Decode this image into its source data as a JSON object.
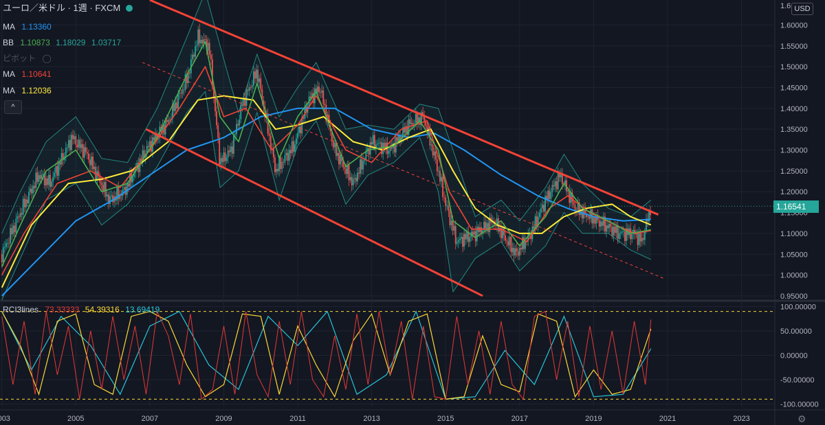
{
  "header": {
    "symbol_title": "ユーロ／米ドル · 1週 · FXCM",
    "currency_button": "USD",
    "last_price_tag": "1.16541",
    "collapse_button": "^"
  },
  "indicators": {
    "ma1": {
      "label": "MA",
      "value": "1.13360",
      "color": "#2196f3"
    },
    "bb": {
      "label": "BB",
      "basis": "1.10873",
      "upper": "1.18029",
      "lower": "1.03717",
      "basis_color": "#4caf50",
      "band_color": "#26a69a"
    },
    "pivot": {
      "label": "ピボット"
    },
    "ma2": {
      "label": "MA",
      "value": "1.10641",
      "color": "#f44336"
    },
    "ma3": {
      "label": "MA",
      "value": "1.12036",
      "color": "#ffeb3b"
    },
    "rci": {
      "label": "RCI3lines",
      "short": "73.33333",
      "mid": "54.39316",
      "long": "13.69419",
      "short_color": "#e53935",
      "mid_color": "#fdd835",
      "long_color": "#26c6da"
    }
  },
  "chart_data": {
    "type": "line",
    "title": "ユーロ／米ドル · 1週 · FXCM",
    "price_axis": {
      "ticks": [
        "1.60000",
        "1.55000",
        "1.50000",
        "1.45000",
        "1.40000",
        "1.35000",
        "1.30000",
        "1.25000",
        "1.20000",
        "1.15000",
        "1.10000",
        "1.05000",
        "1.00000",
        "0.95000"
      ],
      "top_partial_tick": "1.6",
      "range": [
        0.945,
        1.66
      ]
    },
    "rci_axis": {
      "ticks": [
        "100.00000",
        "50.00000",
        "0.00000",
        "-50.00000",
        "-100.00000"
      ],
      "range": [
        -105,
        105
      ],
      "levels": [
        90,
        -90
      ]
    },
    "time_axis": {
      "ticks": [
        "2003",
        "2005",
        "2007",
        "2009",
        "2011",
        "2013",
        "2015",
        "2017",
        "2019",
        "2021",
        "2023"
      ],
      "range": [
        2002.95,
        2023.9
      ]
    },
    "last_price": 1.16541,
    "price_series": {
      "x": [
        2003.0,
        2003.5,
        2004.0,
        2004.3,
        2004.9,
        2005.3,
        2005.9,
        2006.3,
        2006.9,
        2007.5,
        2008.0,
        2008.3,
        2008.6,
        2008.9,
        2009.2,
        2009.5,
        2009.9,
        2010.4,
        2010.9,
        2011.3,
        2011.6,
        2012.0,
        2012.5,
        2013.0,
        2013.5,
        2014.0,
        2014.4,
        2014.8,
        2015.0,
        2015.3,
        2015.8,
        2016.3,
        2016.9,
        2017.3,
        2017.7,
        2018.1,
        2018.5,
        2018.9,
        2019.3,
        2019.7,
        2020.1,
        2020.3,
        2020.55
      ],
      "close": [
        1.05,
        1.15,
        1.24,
        1.22,
        1.33,
        1.29,
        1.18,
        1.2,
        1.3,
        1.37,
        1.47,
        1.57,
        1.55,
        1.27,
        1.3,
        1.41,
        1.49,
        1.25,
        1.31,
        1.42,
        1.45,
        1.3,
        1.22,
        1.32,
        1.3,
        1.36,
        1.38,
        1.25,
        1.17,
        1.08,
        1.1,
        1.13,
        1.05,
        1.1,
        1.18,
        1.24,
        1.16,
        1.14,
        1.12,
        1.1,
        1.1,
        1.08,
        1.165
      ]
    },
    "ma_blue": {
      "x": [
        2003.0,
        2004.0,
        2005.0,
        2006.0,
        2007.0,
        2008.0,
        2009.0,
        2010.0,
        2011.0,
        2012.0,
        2013.0,
        2014.0,
        2014.7,
        2015.5,
        2016.5,
        2017.5,
        2018.3,
        2019.0,
        2019.8,
        2020.55
      ],
      "y": [
        0.95,
        1.04,
        1.13,
        1.18,
        1.24,
        1.3,
        1.33,
        1.38,
        1.4,
        1.4,
        1.35,
        1.33,
        1.34,
        1.3,
        1.24,
        1.19,
        1.16,
        1.14,
        1.13,
        1.1336
      ]
    },
    "ma_yellow": {
      "x": [
        2003.0,
        2003.8,
        2004.8,
        2005.7,
        2006.5,
        2007.5,
        2008.3,
        2009.0,
        2009.8,
        2010.4,
        2011.0,
        2011.7,
        2012.5,
        2013.3,
        2014.0,
        2014.6,
        2015.2,
        2015.8,
        2016.4,
        2017.0,
        2017.6,
        2018.2,
        2018.8,
        2019.5,
        2020.0,
        2020.55
      ],
      "y": [
        0.97,
        1.12,
        1.22,
        1.23,
        1.25,
        1.32,
        1.42,
        1.43,
        1.42,
        1.35,
        1.36,
        1.38,
        1.32,
        1.3,
        1.33,
        1.35,
        1.25,
        1.16,
        1.12,
        1.1,
        1.1,
        1.14,
        1.16,
        1.17,
        1.14,
        1.1204
      ]
    },
    "ma_red": {
      "x": [
        2003.0,
        2003.6,
        2004.5,
        2005.4,
        2006.2,
        2007.0,
        2007.8,
        2008.5,
        2009.0,
        2009.6,
        2010.3,
        2011.0,
        2011.5,
        2012.3,
        2013.0,
        2013.8,
        2014.5,
        2015.1,
        2015.7,
        2016.5,
        2017.2,
        2017.8,
        2018.3,
        2018.9,
        2019.6,
        2020.1,
        2020.55
      ],
      "y": [
        1.0,
        1.1,
        1.22,
        1.25,
        1.21,
        1.3,
        1.4,
        1.5,
        1.38,
        1.4,
        1.3,
        1.36,
        1.43,
        1.3,
        1.27,
        1.35,
        1.37,
        1.2,
        1.11,
        1.11,
        1.08,
        1.16,
        1.19,
        1.15,
        1.12,
        1.1,
        1.1064
      ]
    },
    "bb_basis": {
      "x": [
        2003.0,
        2003.5,
        2004.2,
        2005.0,
        2005.7,
        2006.4,
        2007.2,
        2008.0,
        2008.5,
        2008.9,
        2009.4,
        2009.9,
        2010.5,
        2011.0,
        2011.5,
        2012.3,
        2012.9,
        2013.6,
        2014.3,
        2014.8,
        2015.2,
        2015.8,
        2016.5,
        2017.0,
        2017.7,
        2018.2,
        2018.7,
        2019.4,
        2020.0,
        2020.55
      ],
      "y": [
        1.02,
        1.12,
        1.25,
        1.3,
        1.2,
        1.22,
        1.33,
        1.48,
        1.56,
        1.38,
        1.32,
        1.46,
        1.28,
        1.38,
        1.44,
        1.26,
        1.3,
        1.31,
        1.37,
        1.3,
        1.13,
        1.09,
        1.13,
        1.07,
        1.14,
        1.22,
        1.16,
        1.13,
        1.1,
        1.1087
      ]
    },
    "bb_upper": {
      "x": [
        2003.0,
        2003.5,
        2004.2,
        2005.0,
        2005.7,
        2006.4,
        2007.2,
        2008.0,
        2008.5,
        2008.9,
        2009.4,
        2009.9,
        2010.5,
        2011.0,
        2011.5,
        2012.3,
        2012.9,
        2013.6,
        2014.3,
        2014.8,
        2015.2,
        2015.8,
        2016.5,
        2017.0,
        2017.7,
        2018.2,
        2018.7,
        2019.4,
        2020.0,
        2020.55
      ],
      "y": [
        1.1,
        1.2,
        1.32,
        1.38,
        1.28,
        1.27,
        1.4,
        1.57,
        1.68,
        1.55,
        1.39,
        1.53,
        1.38,
        1.45,
        1.51,
        1.35,
        1.36,
        1.35,
        1.41,
        1.4,
        1.3,
        1.14,
        1.18,
        1.13,
        1.21,
        1.29,
        1.22,
        1.16,
        1.14,
        1.1803
      ]
    },
    "bb_lower": {
      "x": [
        2003.0,
        2003.5,
        2004.2,
        2005.0,
        2005.7,
        2006.4,
        2007.2,
        2008.0,
        2008.5,
        2008.9,
        2009.4,
        2009.9,
        2010.5,
        2011.0,
        2011.5,
        2012.3,
        2012.9,
        2013.6,
        2014.3,
        2014.8,
        2015.2,
        2015.8,
        2016.5,
        2017.0,
        2017.7,
        2018.2,
        2018.7,
        2019.4,
        2020.0,
        2020.55
      ],
      "y": [
        0.94,
        1.04,
        1.18,
        1.22,
        1.12,
        1.17,
        1.26,
        1.39,
        1.44,
        1.21,
        1.25,
        1.39,
        1.18,
        1.31,
        1.37,
        1.17,
        1.24,
        1.27,
        1.33,
        1.2,
        0.96,
        1.04,
        1.08,
        1.01,
        1.07,
        1.15,
        1.1,
        1.1,
        1.06,
        1.0372
      ]
    },
    "channel_upper": {
      "x": [
        2007.0,
        2020.75
      ],
      "y": [
        1.66,
        1.145
      ]
    },
    "channel_lower": {
      "x": [
        2006.9,
        2016.0
      ],
      "y": [
        1.35,
        0.95
      ]
    },
    "channel_mid_dashed": {
      "x": [
        2006.8,
        2020.95
      ],
      "y": [
        1.51,
        0.99
      ]
    },
    "rci": {
      "short": {
        "x": [
          2003.0,
          2003.3,
          2003.6,
          2003.9,
          2004.2,
          2004.5,
          2004.8,
          2005.1,
          2005.4,
          2005.7,
          2006.0,
          2006.3,
          2006.6,
          2006.9,
          2007.2,
          2007.5,
          2007.8,
          2008.1,
          2008.4,
          2008.7,
          2009.0,
          2009.3,
          2009.6,
          2009.9,
          2010.2,
          2010.5,
          2010.8,
          2011.1,
          2011.4,
          2011.7,
          2012.0,
          2012.3,
          2012.6,
          2012.9,
          2013.2,
          2013.5,
          2013.8,
          2014.1,
          2014.4,
          2014.7,
          2015.0,
          2015.3,
          2015.6,
          2015.9,
          2016.2,
          2016.5,
          2016.8,
          2017.1,
          2017.4,
          2017.7,
          2018.0,
          2018.3,
          2018.6,
          2018.9,
          2019.2,
          2019.5,
          2019.8,
          2020.1,
          2020.4,
          2020.55
        ],
        "y": [
          80,
          -60,
          70,
          -80,
          90,
          -40,
          60,
          -90,
          50,
          -70,
          80,
          -50,
          60,
          -80,
          90,
          40,
          -60,
          85,
          -90,
          -70,
          60,
          -80,
          90,
          -40,
          -85,
          70,
          -60,
          90,
          -50,
          -85,
          40,
          -70,
          85,
          -60,
          90,
          -40,
          70,
          -90,
          60,
          -85,
          -90,
          80,
          -60,
          50,
          -80,
          70,
          -60,
          -90,
          80,
          90,
          -50,
          70,
          -85,
          60,
          -70,
          50,
          -80,
          70,
          -60,
          73.33
        ]
      },
      "mid": {
        "x": [
          2003.0,
          2003.5,
          2004.0,
          2004.5,
          2005.0,
          2005.5,
          2006.0,
          2006.5,
          2007.0,
          2007.5,
          2008.0,
          2008.5,
          2009.0,
          2009.5,
          2010.0,
          2010.5,
          2011.0,
          2011.5,
          2012.0,
          2012.5,
          2013.0,
          2013.5,
          2014.0,
          2014.5,
          2015.0,
          2015.5,
          2016.0,
          2016.5,
          2017.0,
          2017.5,
          2018.0,
          2018.5,
          2019.0,
          2019.5,
          2020.0,
          2020.55
        ],
        "y": [
          90,
          20,
          -80,
          70,
          85,
          -60,
          -80,
          80,
          90,
          70,
          -20,
          -85,
          -60,
          85,
          80,
          -80,
          60,
          -20,
          -85,
          30,
          85,
          -40,
          70,
          85,
          -90,
          -85,
          40,
          -60,
          -75,
          85,
          70,
          -85,
          -30,
          -80,
          -70,
          54.39
        ]
      },
      "long": {
        "x": [
          2003.0,
          2003.8,
          2004.6,
          2005.4,
          2006.2,
          2007.0,
          2007.8,
          2008.6,
          2009.4,
          2010.2,
          2011.0,
          2011.8,
          2012.6,
          2013.4,
          2014.2,
          2015.0,
          2015.8,
          2016.6,
          2017.4,
          2018.2,
          2019.0,
          2019.8,
          2020.55
        ],
        "y": [
          90,
          -30,
          80,
          20,
          -80,
          60,
          90,
          -20,
          -70,
          80,
          20,
          90,
          -80,
          -40,
          90,
          -90,
          -85,
          10,
          -60,
          80,
          -85,
          -80,
          13.69
        ]
      }
    }
  }
}
